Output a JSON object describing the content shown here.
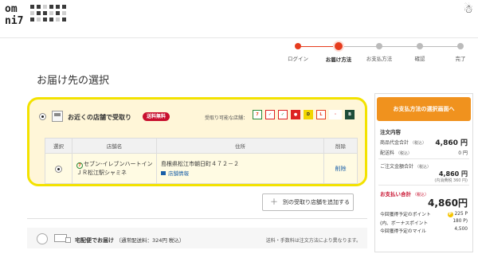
{
  "header": {
    "logo_line1": "om",
    "logo_line2": "ni7"
  },
  "steps": [
    {
      "label": "ログイン",
      "state": "done"
    },
    {
      "label": "お届け方法",
      "state": "current"
    },
    {
      "label": "お支払方法",
      "state": "todo"
    },
    {
      "label": "確認",
      "state": "todo"
    },
    {
      "label": "完了",
      "state": "todo"
    }
  ],
  "page_title": "お届け先の選択",
  "store_pickup": {
    "title": "お近くの店舗で受取り",
    "badge": "送料無料",
    "available_label": "受取り可能な店舗：",
    "store_logos": [
      "seven-eleven-icon",
      "ito-yokado-icon",
      "sogo-seibu-icon",
      "york-benimaru-icon",
      "denny's-icon",
      "loft-icon",
      "akachan-honpo-icon",
      "barneys-icon"
    ],
    "table": {
      "headers": [
        "選択",
        "店舗名",
        "住所",
        "削除"
      ],
      "rows": [
        {
          "name_line1": "セブン-イレブンハートイン",
          "name_line2": "ＪＲ松江駅シャミネ",
          "address": "島根県松江市朝日町４７２－２",
          "store_info": "店舗情報",
          "delete": "削除"
        }
      ]
    },
    "add_store_button": "別の受取り店舗を追加する"
  },
  "home_delivery": {
    "title": "宅配便でお届け",
    "fee": "（通常配送料：324円 税込）",
    "note": "送料・手数料は注文方法により異なります。"
  },
  "summary": {
    "to_payment_button": "お支払方法の選択画面へ",
    "order_details": "注文内容",
    "subtotal_label": "商品代金合計",
    "tax_in": "（税込）",
    "subtotal": "4,860 円",
    "shipping_label": "配送料",
    "shipping": "0 円",
    "order_total_label": "ご注文金額合計",
    "order_total": "4,860 円",
    "order_total_note": "(内消費税 360 円)",
    "payment_label": "お支払い合計",
    "payment_total": "4,860円",
    "points_label": "今回獲得予定のポイント",
    "points": "225",
    "bonus_label": "(内、ボーナスポイント",
    "bonus": "180 P)",
    "miles_label": "今回獲得予定のマイル",
    "miles": "4,500"
  },
  "colors": {
    "accent_orange": "#f0921e",
    "highlight_yellow": "#f3e200",
    "badge_red": "#c8102e",
    "step_red": "#e63c1e"
  }
}
